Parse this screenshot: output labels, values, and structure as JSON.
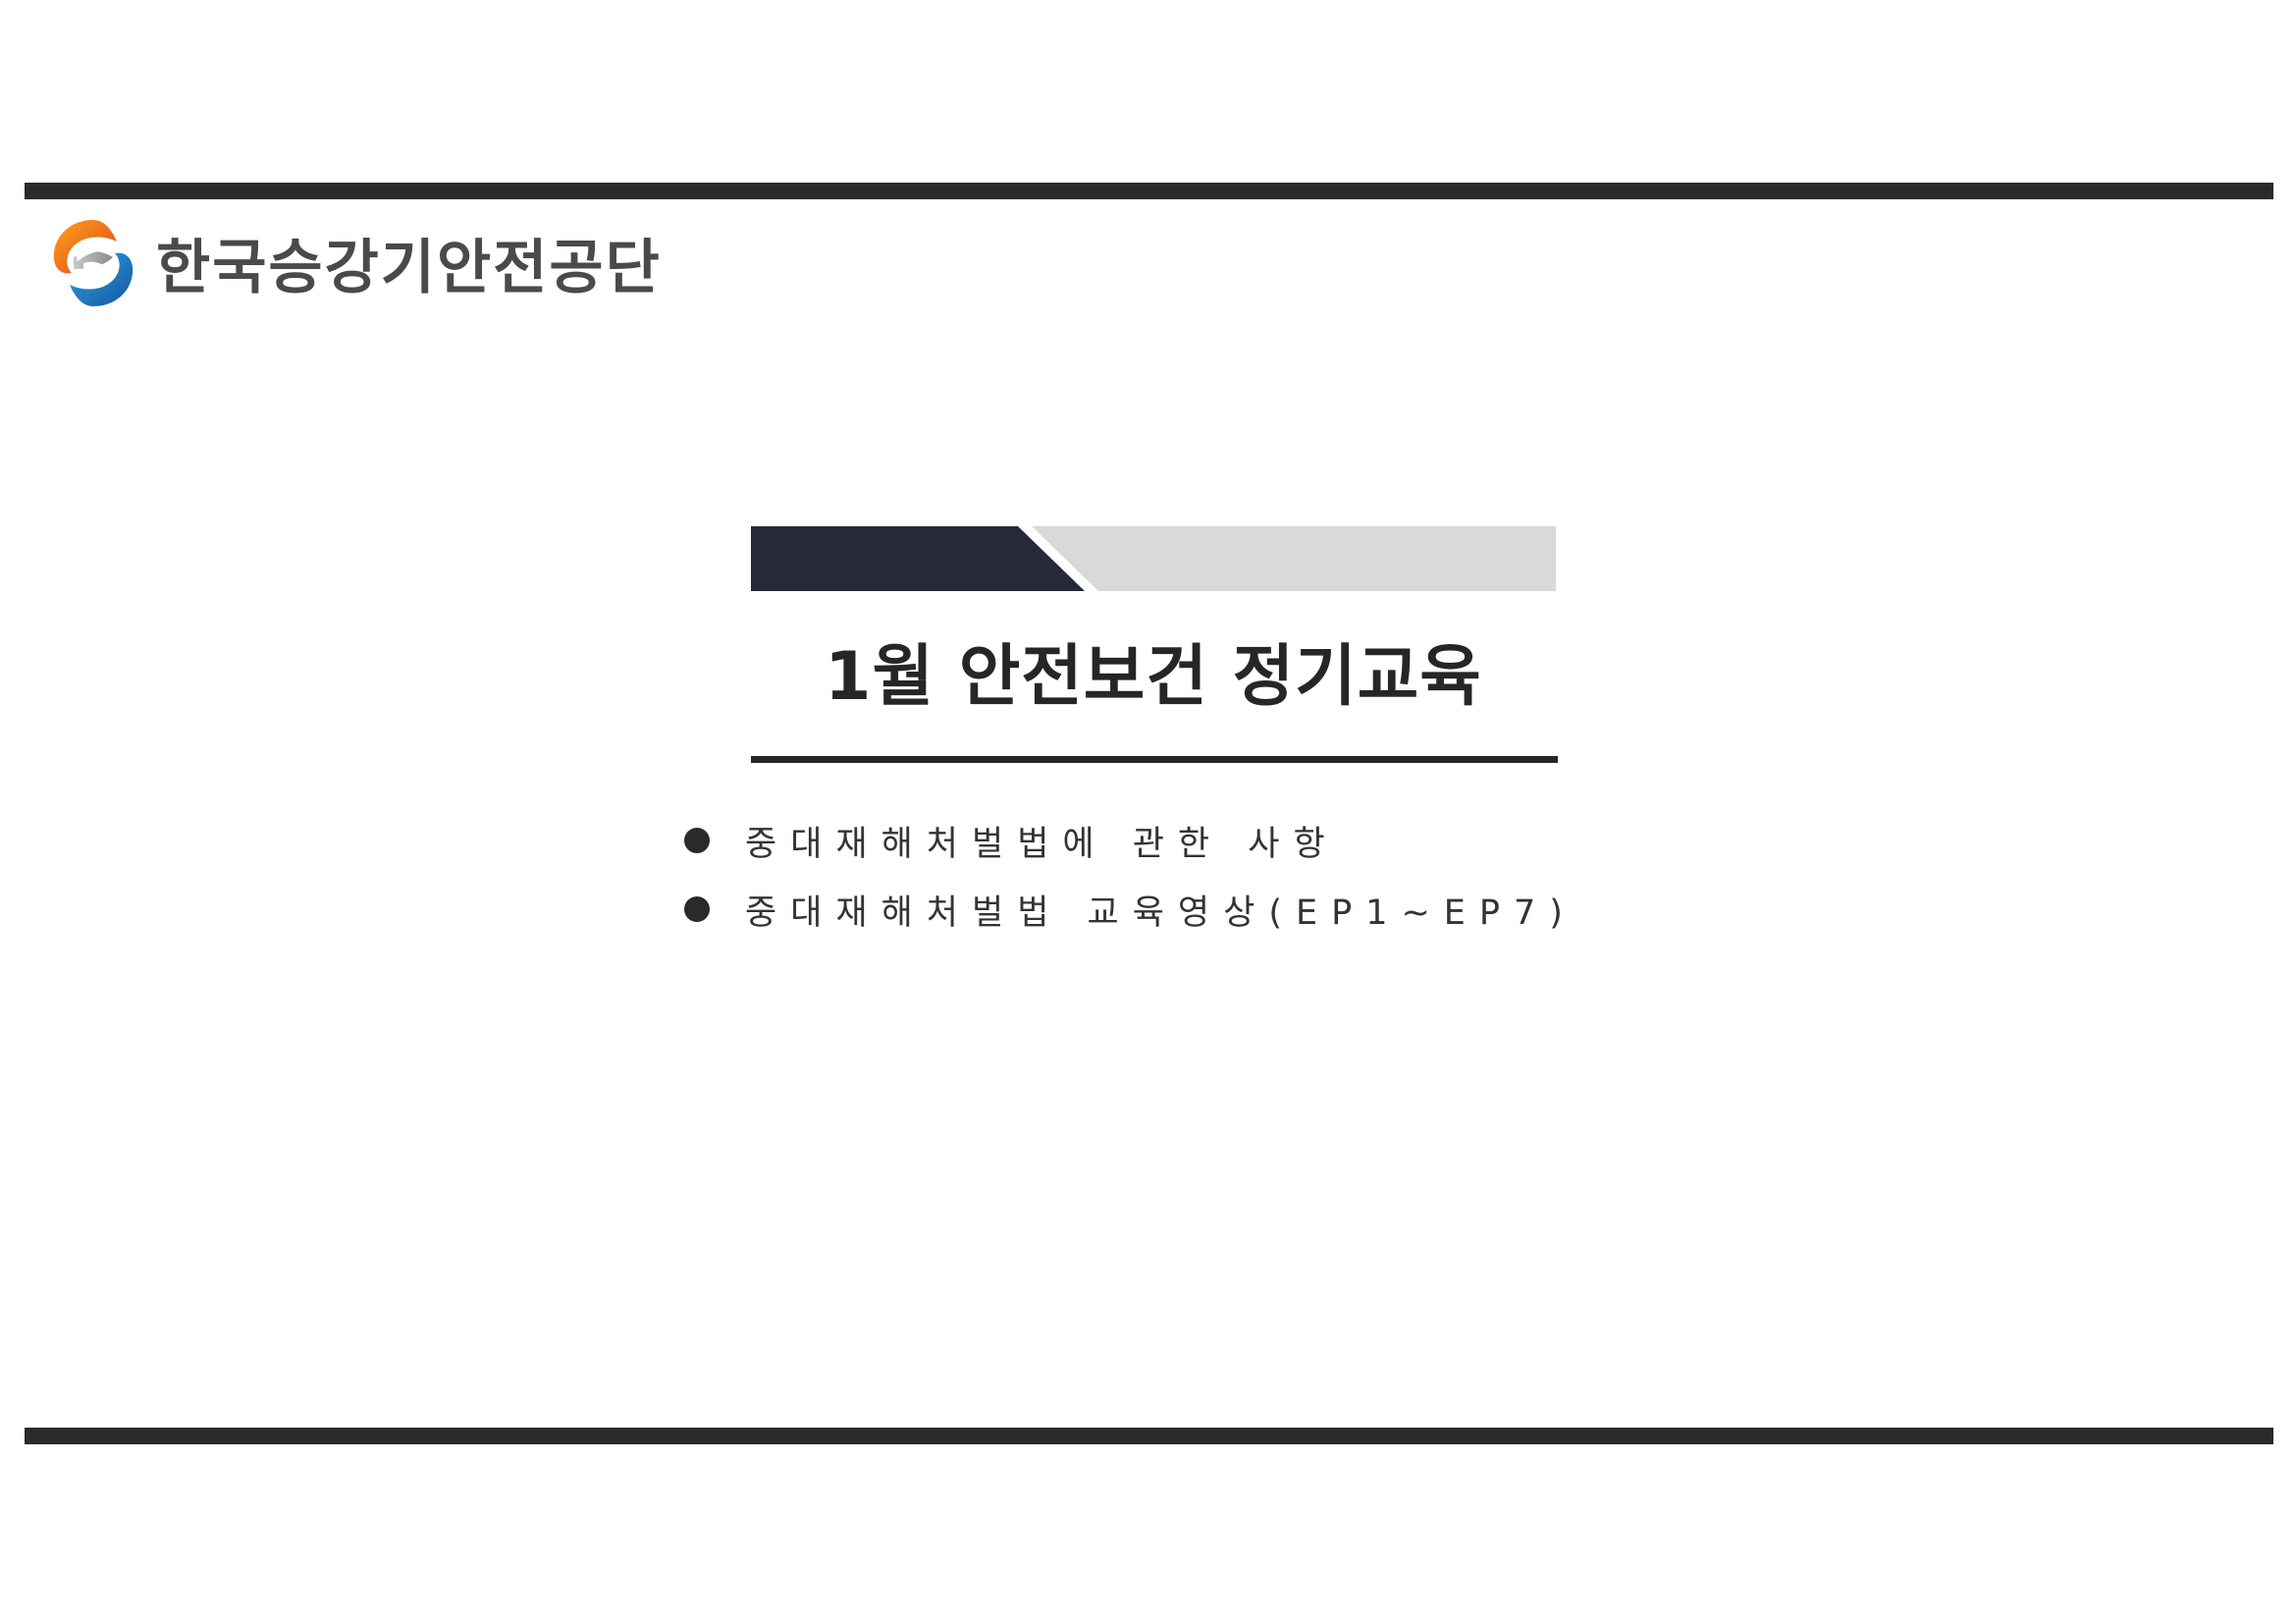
{
  "logo": {
    "name": "한국승강기안전공단",
    "emblem_colors": [
      "#f7941d",
      "#e84e1b",
      "#1b75bb",
      "#9a9a9a"
    ]
  },
  "title": "1월 안전보건 정기교육",
  "bullets": [
    "중대재해처벌법에 관한 사항",
    "중대재해처벌법 교육영상(EP1~EP7)"
  ],
  "colors": {
    "rule": "#2b2b2b",
    "banner_dark": "#252a36",
    "banner_light": "#d9d9d9",
    "text": "#2a2a2a"
  }
}
